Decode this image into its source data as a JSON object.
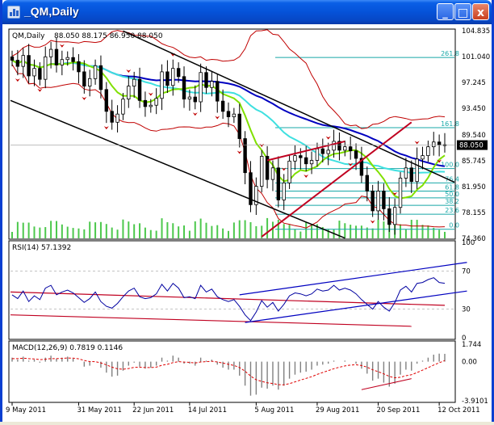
{
  "window": {
    "title": "_QM,Daily",
    "minimize_glyph": "_",
    "maximize_glyph": "□",
    "close_glyph": "x"
  },
  "colors": {
    "titlebar": "#0552d8",
    "candle": "#000000",
    "bollinger": "#c00000",
    "ma_green": "#80e000",
    "ma_cyan": "#3fe0e0",
    "ma_blue": "#0000c0",
    "fib": "#18a8a8",
    "volume": "#4cc84c",
    "channel": "#000000",
    "channel_red": "#c00020",
    "rsi_line": "#0000a0",
    "macd_hist": "#808080",
    "macd_signal": "#e00000"
  },
  "chart_data": [
    {
      "type": "candlestick",
      "title": "QM,Daily",
      "ohlc_label": "88.050 88.175 86.950 88.050",
      "current_price": "88.050",
      "ylim": [
        74.36,
        104.835
      ],
      "y_tick_labels": [
        "104.835",
        "101.040",
        "97.245",
        "93.450",
        "89.540",
        "85.745",
        "81.950",
        "78.155",
        "74.360"
      ],
      "y_tick_values": [
        104.835,
        101.04,
        97.245,
        93.45,
        89.54,
        85.745,
        81.95,
        78.155,
        74.36
      ],
      "fibonacci_levels": [
        {
          "label": "261.8",
          "value": 100.9
        },
        {
          "label": "161.8",
          "value": 90.6
        },
        {
          "label": "100.0",
          "value": 84.6
        },
        {
          "label": "76.4",
          "value": 82.5
        },
        {
          "label": "61.8",
          "value": 81.3
        },
        {
          "label": "50.0",
          "value": 80.3
        },
        {
          "label": "38.2",
          "value": 79.2
        },
        {
          "label": "23.6",
          "value": 77.9
        },
        {
          "label": "0.0",
          "value": 75.7
        }
      ],
      "closes": [
        100.5,
        99.6,
        101.2,
        98.2,
        99.3,
        97.7,
        101.0,
        102.1,
        99.8,
        100.6,
        100.9,
        100.3,
        98.8,
        96.7,
        97.8,
        99.7,
        96.2,
        93.0,
        91.4,
        92.6,
        94.8,
        96.7,
        97.7,
        94.6,
        93.7,
        93.9,
        94.9,
        98.8,
        96.8,
        99.3,
        98.1,
        94.8,
        95.1,
        94.4,
        98.7,
        96.5,
        97.4,
        94.5,
        93.0,
        92.2,
        92.6,
        89.0,
        84.0,
        79.3,
        82.0,
        86.4,
        83.0,
        84.7,
        80.0,
        82.5,
        85.7,
        86.5,
        86.2,
        85.3,
        85.8,
        87.5,
        86.8,
        87.3,
        88.6,
        87.3,
        87.8,
        87.2,
        86.1,
        83.6,
        81.3,
        78.4,
        81.3,
        78.7,
        76.4,
        78.9,
        83.2,
        84.7,
        82.7,
        86.0,
        86.5,
        87.8,
        88.5,
        88.1,
        88.05
      ]
    },
    {
      "type": "line",
      "title": "RSI(14) 57.1392",
      "ylim": [
        0,
        100
      ],
      "y_tick_labels": [
        "100",
        "70",
        "30",
        "0"
      ],
      "y_tick_values": [
        100,
        70,
        30,
        0
      ],
      "values": [
        45,
        41,
        49,
        38,
        44,
        40,
        52,
        55,
        45,
        48,
        50,
        47,
        42,
        37,
        41,
        48,
        38,
        33,
        31,
        36,
        43,
        49,
        52,
        43,
        41,
        42,
        46,
        56,
        49,
        57,
        52,
        42,
        43,
        41,
        55,
        48,
        51,
        43,
        40,
        38,
        40,
        33,
        24,
        18,
        27,
        39,
        32,
        37,
        28,
        35,
        44,
        47,
        46,
        44,
        46,
        51,
        49,
        50,
        55,
        50,
        52,
        50,
        46,
        40,
        35,
        30,
        38,
        32,
        28,
        37,
        50,
        54,
        48,
        57,
        58,
        61,
        63,
        58,
        57.14
      ]
    },
    {
      "type": "histogram",
      "title": "MACD(12,26,9) 0.7819 0.1146",
      "ylim": [
        -3.9101,
        1.744
      ],
      "y_tick_labels": [
        "1.744",
        "0.00",
        "-3.9101"
      ],
      "y_tick_values": [
        1.744,
        0,
        -3.9101
      ],
      "values": [
        0.4,
        0.2,
        0.5,
        0.1,
        0.2,
        -0.1,
        0.4,
        0.6,
        0.3,
        0.4,
        0.5,
        0.3,
        0.0,
        -0.5,
        -0.4,
        0.0,
        -0.6,
        -1.1,
        -1.5,
        -1.4,
        -0.9,
        -0.4,
        -0.1,
        -0.5,
        -0.7,
        -0.6,
        -0.4,
        0.4,
        0.1,
        0.6,
        0.4,
        -0.2,
        -0.2,
        -0.4,
        0.4,
        0.1,
        0.2,
        -0.3,
        -0.6,
        -0.8,
        -0.8,
        -1.4,
        -2.4,
        -3.4,
        -3.3,
        -2.6,
        -2.7,
        -2.4,
        -2.8,
        -2.4,
        -1.7,
        -1.3,
        -1.1,
        -1.0,
        -0.8,
        -0.4,
        -0.3,
        -0.2,
        0.1,
        0.0,
        0.1,
        0.0,
        -0.2,
        -0.7,
        -1.2,
        -1.9,
        -1.7,
        -2.1,
        -2.5,
        -2.2,
        -1.3,
        -0.8,
        -0.9,
        -0.2,
        0.1,
        0.4,
        0.7,
        0.8,
        0.78
      ],
      "signal": [
        0.3,
        0.3,
        0.35,
        0.3,
        0.27,
        0.2,
        0.24,
        0.31,
        0.3,
        0.32,
        0.36,
        0.35,
        0.28,
        0.12,
        0.01,
        0.0,
        -0.12,
        -0.32,
        -0.55,
        -0.72,
        -0.76,
        -0.69,
        -0.57,
        -0.56,
        -0.59,
        -0.59,
        -0.55,
        -0.36,
        -0.27,
        -0.1,
        0.0,
        -0.04,
        -0.07,
        -0.14,
        -0.03,
        0.0,
        0.04,
        -0.03,
        -0.14,
        -0.27,
        -0.38,
        -0.58,
        -0.95,
        -1.44,
        -1.81,
        -1.97,
        -2.12,
        -2.18,
        -2.3,
        -2.32,
        -2.2,
        -2.02,
        -1.84,
        -1.67,
        -1.5,
        -1.28,
        -1.08,
        -0.9,
        -0.7,
        -0.56,
        -0.43,
        -0.34,
        -0.31,
        -0.39,
        -0.55,
        -0.82,
        -1.0,
        -1.22,
        -1.48,
        -1.62,
        -1.56,
        -1.41,
        -1.31,
        -1.09,
        -0.85,
        -0.6,
        -0.34,
        -0.11,
        0.11
      ]
    }
  ],
  "x_axis": {
    "labels": [
      "9 May 2011",
      "31 May 2011",
      "22 Jun 2011",
      "14 Jul 2011",
      "5 Aug 2011",
      "29 Aug 2011",
      "20 Sep 2011",
      "12 Oct 2011"
    ],
    "label_bar_index": [
      0,
      15,
      28,
      41,
      57,
      71,
      85,
      99
    ]
  }
}
